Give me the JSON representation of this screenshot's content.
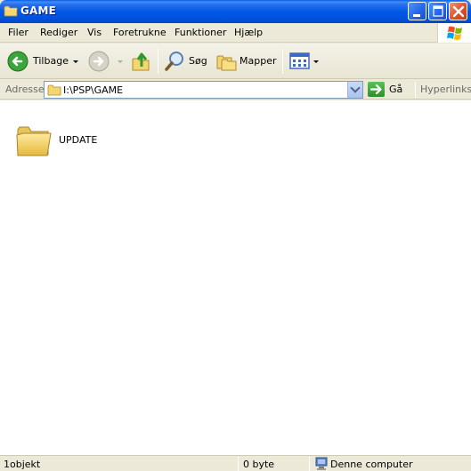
{
  "window": {
    "title": "GAME"
  },
  "menu": [
    "Filer",
    "Rediger",
    "Vis",
    "Foretrukne",
    "Funktioner",
    "Hjælp"
  ],
  "toolbar": {
    "back_label": "Tilbage",
    "search_label": "Søg",
    "folders_label": "Mapper"
  },
  "address": {
    "label": "Adresse",
    "path": "I:\\PSP\\GAME",
    "go_label": "Gå",
    "links_label": "Hyperlinks"
  },
  "files": [
    {
      "name": "UPDATE",
      "icon": "folder-icon"
    }
  ],
  "status": {
    "objects": "1objekt",
    "size": "0 byte",
    "location": "Denne computer"
  },
  "colors": {
    "titlebar": "#0058e6",
    "chrome": "#ece9d8",
    "close_button": "#e0502a",
    "content": "#ffffff"
  }
}
